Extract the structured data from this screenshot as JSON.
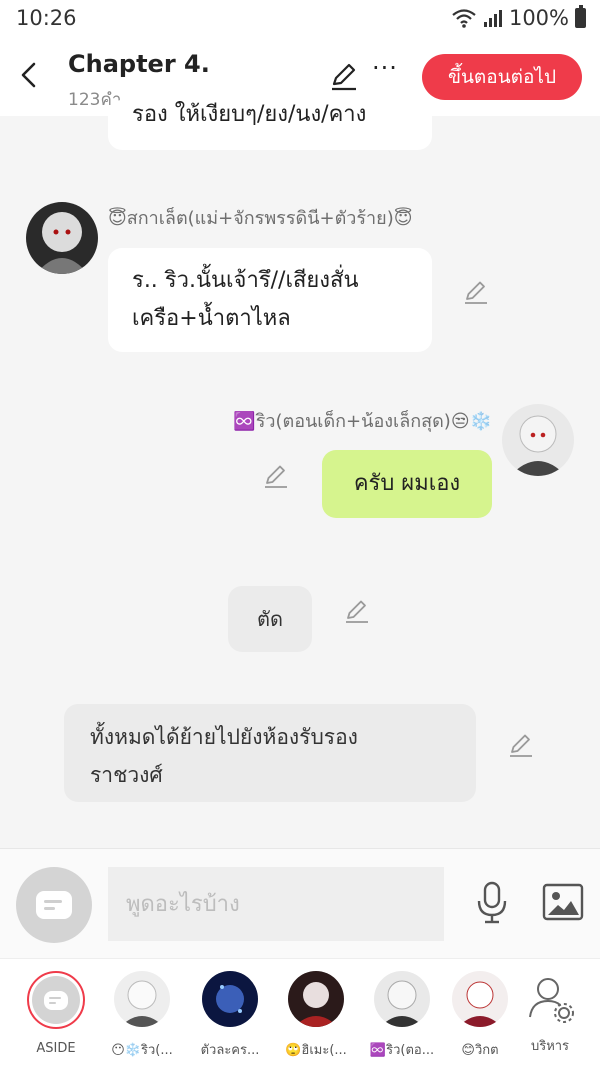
{
  "status": {
    "time": "10:26",
    "battery": "100%"
  },
  "header": {
    "title": "Chapter 4.",
    "word_count": "123คำ",
    "next_label": "ขึ้นตอนต่อไป"
  },
  "messages": {
    "cut_off_text": "รอง ให้เงียบๆ/ยง/นง/คาง",
    "m1": {
      "name": "😇สกาเล็ต(แม่+จักรพรรดินี+ตัวร้าย)😇",
      "line1": "ร.. ริว.นั้นเจ้ารึ//เสียงสั่น",
      "line2": "เครือ+น้ำตาไหล"
    },
    "m2": {
      "name": "♾️ริว(ตอนเด็ก+น้องเล็กสุด)😒❄️",
      "text": "ครับ ผมเอง"
    },
    "m3": {
      "text": "ตัด"
    },
    "m4": {
      "line1": "ทั้งหมดได้ย้ายไปยังห้องรับรอง",
      "line2": "ราชวงศ์"
    }
  },
  "input": {
    "placeholder": "พูดอะไรบ้าง"
  },
  "characters": [
    {
      "label": "ASIDE"
    },
    {
      "label": "😶❄️ริว(..."
    },
    {
      "label": "ตัวละคร..."
    },
    {
      "label": "🙄ฮิเมะ(..."
    },
    {
      "label": "♾️ริว(ตอ..."
    },
    {
      "label": "😊วิกต"
    },
    {
      "label": "บริหาร"
    }
  ],
  "colors": {
    "accent": "#ef3b4a",
    "right_bubble": "#d6f48e",
    "background": "#f5f5f5"
  }
}
